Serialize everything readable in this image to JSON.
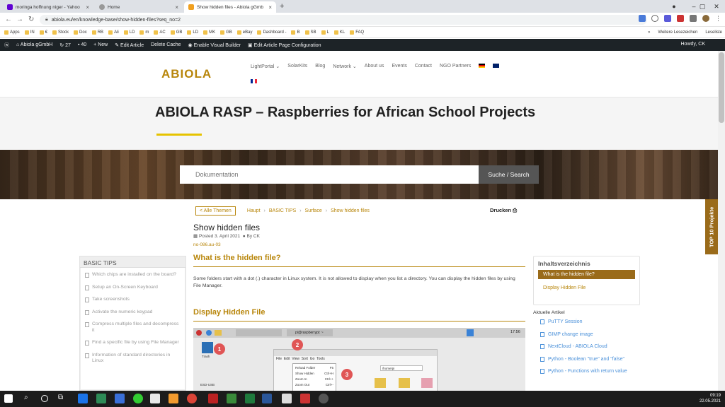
{
  "browser": {
    "tabs": [
      {
        "label": "moringa hoffnung niger - Yahoo",
        "active": false,
        "color": "#6001d2"
      },
      {
        "label": "Home",
        "active": false,
        "color": "#777777"
      },
      {
        "label": "Show hidden files - Abiola gGmb",
        "active": true,
        "color": "#f0a020"
      }
    ],
    "url": "abiola.eu/en/knowledge-base/show-hidden-files?seq_no=2",
    "bookmarks": [
      "Apps",
      "IN",
      "€",
      "Stock",
      "Doc",
      "RB",
      "Ali",
      "LD",
      "m",
      "AC",
      "GB",
      "LD",
      "MK",
      "GB",
      "eBay",
      "Dashboard -",
      "B",
      "SB",
      "L",
      "KL",
      "FAQ"
    ],
    "bookmarks_right": [
      "»",
      "Weitere Lesezeichen",
      "Leseliste"
    ]
  },
  "wp_admin": {
    "site": "Abiola gGmbH",
    "updates": "27",
    "comments": "40",
    "new": "New",
    "edit_article": "Edit Article",
    "delete_cache": "Delete Cache",
    "visual_builder": "Enable Visual Builder",
    "config": "Edit Article Page Configuration",
    "howdy": "Howdy, CK"
  },
  "site": {
    "logo": "ABIOLA",
    "menu": [
      "LightPortal ⌄",
      "SolarKits",
      "Blog",
      "Network ⌄",
      "About us",
      "Events",
      "Contact",
      "NGO Partners"
    ],
    "page_title": "ABIOLA RASP – Raspberries for African School Projects",
    "search_placeholder": "Dokumentation",
    "search_button": "Suche / Search"
  },
  "breadcrumb": {
    "all_topics": "< Alle Themen",
    "items": [
      "Haupt",
      "BASIC TIPS",
      "Surface",
      "Show hidden files"
    ],
    "print": "Drucken"
  },
  "post": {
    "title": "Show hidden files",
    "date": "Posted 3. April 2021",
    "author": "By CK",
    "id": "no-086.au-03",
    "section1": "What is the hidden file?",
    "section1_text": "Some folders start with a dot (.) character in Linux system. It is not allowed to display when you list a directory. You can display the hidden files by using File Manager.",
    "section2": "Display Hidden File"
  },
  "screenshot_labels": {
    "user": "pi@raspberrypi: ~",
    "time": "17:56",
    "trash": "Trash",
    "usb": "ESD-USB",
    "path": "/home/pi",
    "menu": [
      "File",
      "Edit",
      "View",
      "Sort",
      "Go",
      "Tools"
    ],
    "dropdown": [
      {
        "label": "Reload Folder",
        "shortcut": "F5"
      },
      {
        "label": "Show Hidden",
        "shortcut": "Ctrl+H"
      },
      {
        "label": "Zoom In",
        "shortcut": "Ctrl++"
      },
      {
        "label": "Zoom Out",
        "shortcut": "Ctrl+-"
      }
    ],
    "steps": [
      "1",
      "2",
      "3"
    ]
  },
  "sidebar": {
    "title": "BASIC TIPS",
    "items": [
      "Which chips are installed on the board?",
      "Setup an On-Screen Keyboard",
      "Take screenshots",
      "Activate the numeric keypad",
      "Compress multiple files and decompress it",
      "Find a specific file by using File Manager",
      "Information of standard directories in Linux"
    ]
  },
  "toc": {
    "title": "Inhaltsverzeichnis",
    "items": [
      "What is the hidden file?",
      "Display Hidden File"
    ]
  },
  "recent": {
    "title": "Aktuelle Artikel",
    "items": [
      "PuTTY Session",
      "GIMP change image",
      "NextCloud - ABIOLA Cloud",
      "Python - Boolean \"true\" and \"false\"",
      "Python - Functions with return value"
    ]
  },
  "top10_tab": "TOP 10 Projekte",
  "taskbar": {
    "time": "09:19",
    "date": "22.05.2021"
  },
  "colors": {
    "accent": "#b8860b",
    "dark_accent": "#9a6b1a",
    "wp_bar": "#1d2327",
    "link": "#4a90d9"
  }
}
